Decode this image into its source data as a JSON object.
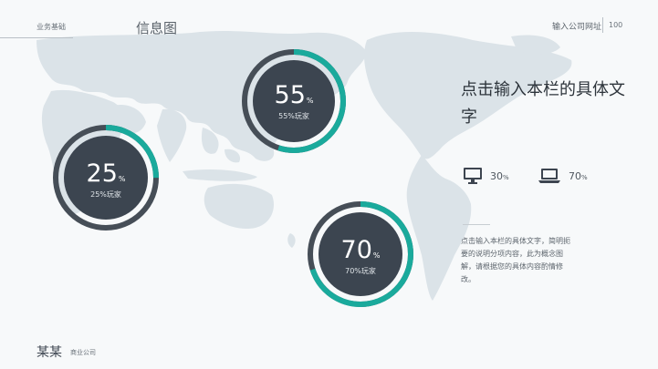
{
  "header": {
    "section_tag": "业务基础",
    "title": "信息图",
    "company_url": "输入公司网址",
    "page_number": "100"
  },
  "rings": [
    {
      "value": "55",
      "unit": "%",
      "caption": "55%玩家",
      "percent": 55
    },
    {
      "value": "25",
      "unit": "%",
      "caption": "25%玩家",
      "percent": 25
    },
    {
      "value": "70",
      "unit": "%",
      "caption": "70%玩家",
      "percent": 70
    }
  ],
  "panel": {
    "headline": "点击输入本栏的具体文字",
    "devices": [
      {
        "icon": "monitor-icon",
        "value": "30",
        "unit": "%"
      },
      {
        "icon": "laptop-icon",
        "value": "70",
        "unit": "%"
      }
    ],
    "description": "点击输入本栏的具体文字，简明扼要的说明分项内容，此为概念图解，请根据您的具体内容酌情修改。"
  },
  "footer": {
    "company_name": "某某",
    "company_suffix": "商业公司"
  },
  "colors": {
    "accent": "#1aaa9c",
    "ring_dark": "#464e57",
    "center": "#3c4550",
    "map": "#dbe3e8"
  }
}
